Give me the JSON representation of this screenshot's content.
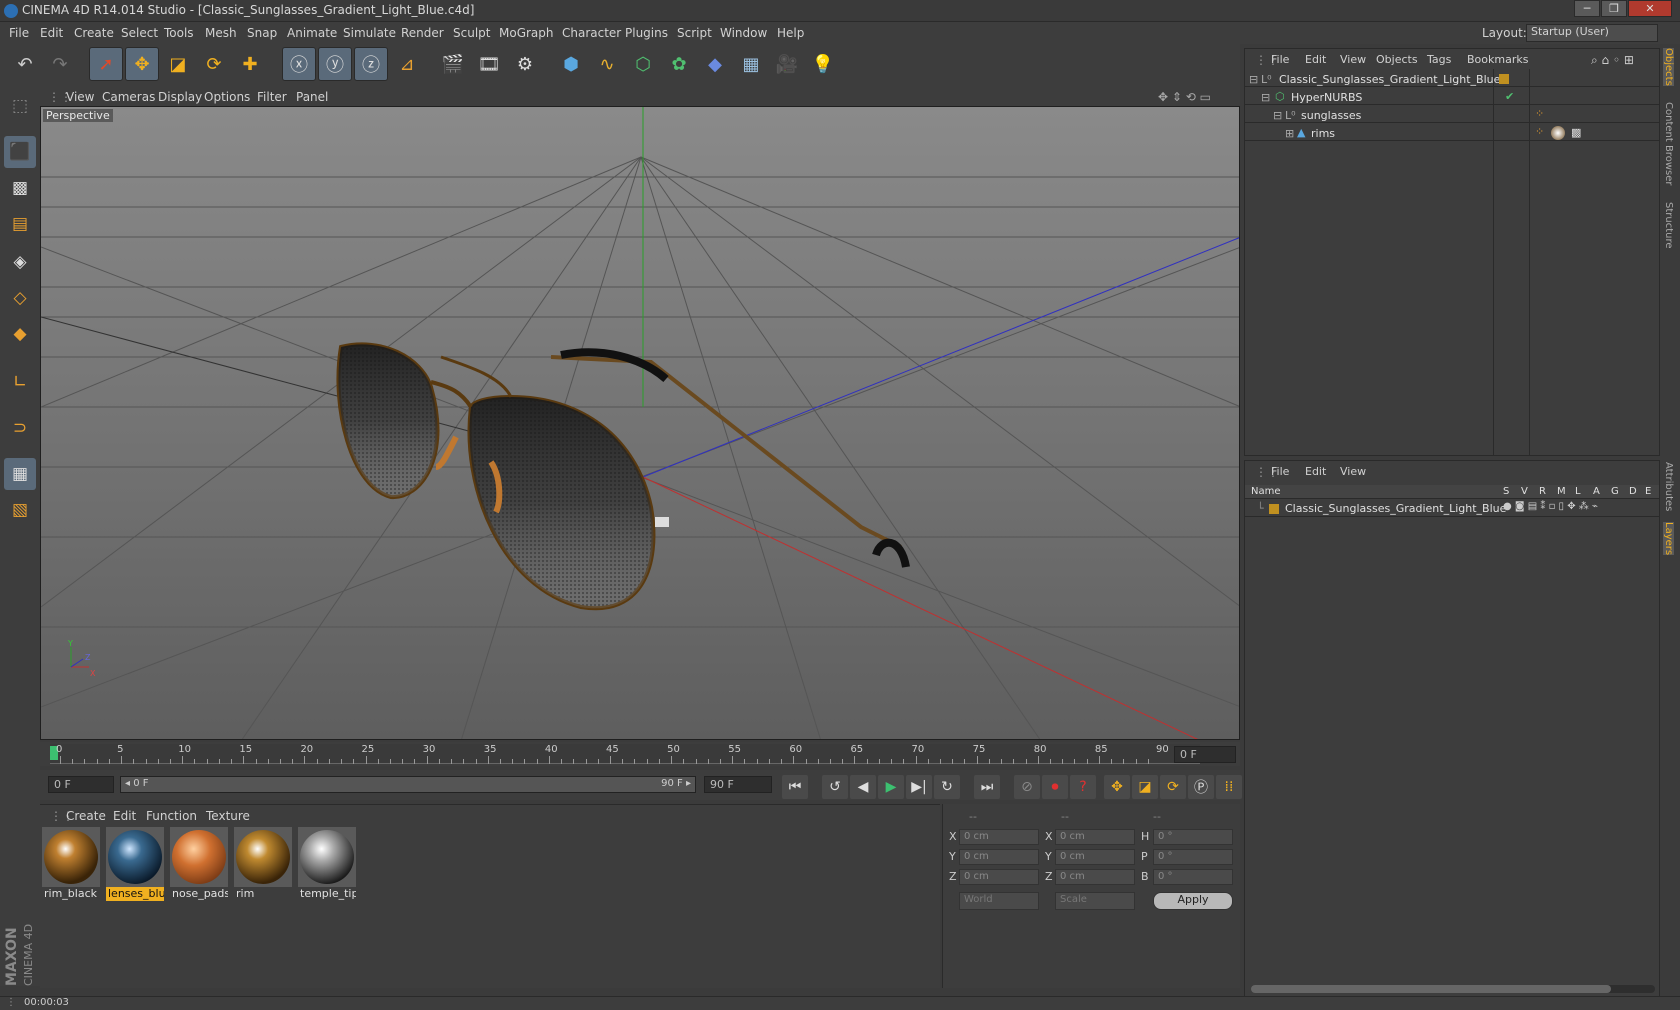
{
  "window": {
    "title": "CINEMA 4D R14.014 Studio - [Classic_Sunglasses_Gradient_Light_Blue.c4d]",
    "minimize": "─",
    "maximize": "❐",
    "close": "✕"
  },
  "menubar": {
    "items": [
      "File",
      "Edit",
      "Create",
      "Select",
      "Tools",
      "Mesh",
      "Snap",
      "Animate",
      "Simulate",
      "Render",
      "Sculpt",
      "MoGraph",
      "Character",
      "Plugins",
      "Script",
      "Window",
      "Help"
    ],
    "layout_label": "Layout:",
    "layout_value": "Startup (User)"
  },
  "viewport": {
    "menu": [
      "View",
      "Cameras",
      "Display",
      "Options",
      "Filter",
      "Panel"
    ],
    "label": "Perspective",
    "axis_x": "X",
    "axis_y": "Y",
    "axis_z": "Z"
  },
  "timeline": {
    "ticks": [
      "0",
      "5",
      "10",
      "15",
      "20",
      "25",
      "30",
      "35",
      "40",
      "45",
      "50",
      "55",
      "60",
      "65",
      "70",
      "75",
      "80",
      "85",
      "90"
    ],
    "current_frame": "0 F"
  },
  "transport": {
    "start_field": "0 F",
    "range_left": "◂ 0 F",
    "range_right": "90 F ▸",
    "end_field": "90 F"
  },
  "materials": {
    "menu": [
      "Create",
      "Edit",
      "Function",
      "Texture"
    ],
    "items": [
      {
        "name": "rim_black",
        "selected": false
      },
      {
        "name": "lenses_blue",
        "selected": true
      },
      {
        "name": "nose_pads",
        "selected": false
      },
      {
        "name": "rim",
        "selected": false
      },
      {
        "name": "temple_tip",
        "selected": false
      }
    ]
  },
  "coordinates": {
    "headers": [
      "--",
      "--",
      "--"
    ],
    "rows": [
      {
        "l1": "X",
        "v1": "0 cm",
        "l2": "X",
        "v2": "0 cm",
        "l3": "H",
        "v3": "0 °"
      },
      {
        "l1": "Y",
        "v1": "0 cm",
        "l2": "Y",
        "v2": "0 cm",
        "l3": "P",
        "v3": "0 °"
      },
      {
        "l1": "Z",
        "v1": "0 cm",
        "l2": "Z",
        "v2": "0 cm",
        "l3": "B",
        "v3": "0 °"
      }
    ],
    "mode": "World",
    "type": "Scale",
    "apply": "Apply"
  },
  "objects": {
    "menu": [
      "File",
      "Edit",
      "View",
      "Objects",
      "Tags",
      "Bookmarks"
    ],
    "tree": [
      {
        "name": "Classic_Sunglasses_Gradient_Light_Blue"
      },
      {
        "name": "HyperNURBS"
      },
      {
        "name": "sunglasses"
      },
      {
        "name": "rims"
      }
    ]
  },
  "layers": {
    "menu": [
      "File",
      "Edit",
      "View"
    ],
    "header_name": "Name",
    "columns": [
      "S",
      "V",
      "R",
      "M",
      "L",
      "A",
      "G",
      "D",
      "E"
    ],
    "rows": [
      "Classic_Sunglasses_Gradient_Light_Blue"
    ]
  },
  "right_tabs": [
    "Objects",
    "Content Browser",
    "Structure",
    "Attributes",
    "Layers"
  ],
  "status": {
    "time": "00:00:03"
  },
  "logo": {
    "line1": "MAXON",
    "line2": "CINEMA 4D"
  }
}
